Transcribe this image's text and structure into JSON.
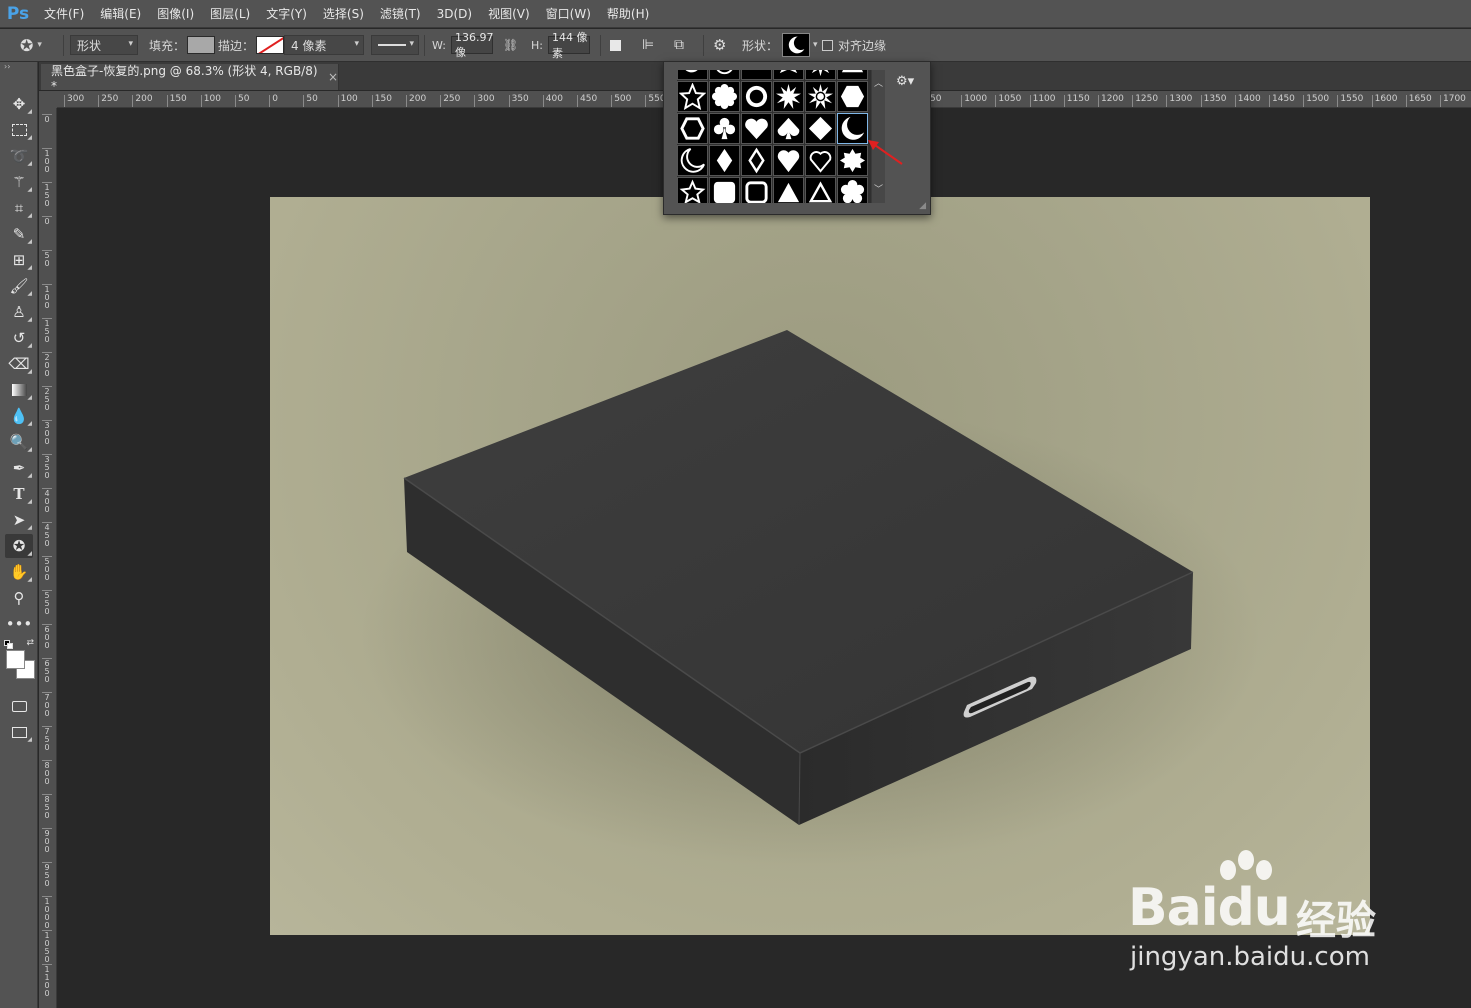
{
  "app": {
    "logo": "Ps"
  },
  "menu": [
    "文件(F)",
    "编辑(E)",
    "图像(I)",
    "图层(L)",
    "文字(Y)",
    "选择(S)",
    "滤镜(T)",
    "3D(D)",
    "视图(V)",
    "窗口(W)",
    "帮助(H)"
  ],
  "options": {
    "mode": "形状",
    "fill_label": "填充：",
    "stroke_label": "描边：",
    "stroke_width": "4 像素",
    "width_label": "W:",
    "width_value": "136.97 像",
    "height_label": "H:",
    "height_value": "144 像素",
    "shape_label": "形状：",
    "align_edges": "对齐边缘",
    "fill_color": "#a8a8a8"
  },
  "document": {
    "tab_title": "黑色盒子-恢复的.png @ 68.3% (形状 4, RGB/8) *",
    "close": "×"
  },
  "ruler": {
    "h": [
      "300",
      "250",
      "200",
      "150",
      "100",
      "50",
      "0",
      "50",
      "100",
      "150",
      "200",
      "250",
      "300",
      "350",
      "400",
      "450",
      "500",
      "550",
      "50",
      "1000",
      "1050",
      "1100",
      "1150",
      "1200",
      "1250",
      "1300",
      "1350",
      "1400",
      "1450",
      "1500",
      "1550",
      "1600",
      "1650",
      "1700"
    ],
    "v": [
      "0",
      "100",
      "150",
      "0",
      "50",
      "100",
      "150",
      "200",
      "250",
      "300",
      "350",
      "400",
      "450",
      "500",
      "550",
      "600",
      "650",
      "700",
      "750",
      "800",
      "850",
      "900",
      "950",
      "1000",
      "1050",
      "1100"
    ]
  },
  "shape_picker": {
    "rows": [
      [
        "swirl",
        "ring",
        "banner",
        "burst",
        "burst2",
        "flag"
      ],
      [
        "star",
        "flower8",
        "scallop-ring",
        "starburst",
        "sun-burst",
        "hexagon"
      ],
      [
        "hexagon-outline",
        "club",
        "heart",
        "spade",
        "diamond",
        "crescent"
      ],
      [
        "crescent-outline",
        "diamond-tall",
        "diamond-outline",
        "heart-solid",
        "heart-outline",
        "seal"
      ],
      [
        "star-outline",
        "rounded-square",
        "rounded-square-outline",
        "triangle",
        "triangle-outline",
        "flower"
      ]
    ],
    "selected": "crescent"
  },
  "watermark": {
    "brand": "Bai",
    "brand2": "du",
    "cn": "经验",
    "url": "jingyan.baidu.com"
  },
  "colors": {
    "annotation": "#e02020",
    "accent": "#4aa3e8"
  }
}
